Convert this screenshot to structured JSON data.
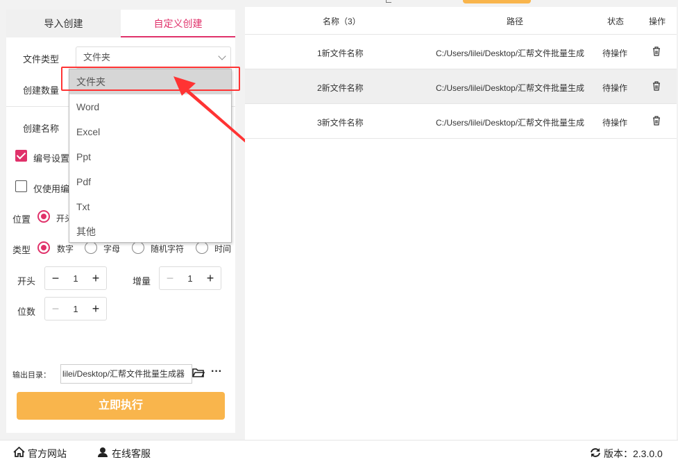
{
  "tabs": [
    {
      "label": "导入创建",
      "active": false
    },
    {
      "label": "自定义创建",
      "active": true
    }
  ],
  "form": {
    "file_type_label": "文件类型",
    "file_type_value": "文件夹",
    "create_count_label": "创建数量",
    "create_name_label": "创建名称",
    "numbering_label": "编号设置",
    "numbering_checked": true,
    "only_number_label": "仅使用编",
    "only_number_checked": false,
    "position_label": "位置",
    "position_option": "开头",
    "type_label": "类型",
    "type_options": [
      {
        "label": "数字",
        "selected": true
      },
      {
        "label": "字母",
        "selected": false
      },
      {
        "label": "随机字符",
        "selected": false
      },
      {
        "label": "时间",
        "selected": false
      }
    ],
    "start_label": "开头",
    "start_value": "1",
    "increment_label": "增量",
    "increment_value": "1",
    "digits_label": "位数",
    "digits_value": "1",
    "output_label": "输出目录：",
    "output_value": "lilei/Desktop/汇帮文件批量生成器",
    "execute_label": "立即执行"
  },
  "dropdown": {
    "options": [
      "文件夹",
      "Word",
      "Excel",
      "Ppt",
      "Pdf",
      "Txt",
      "其他"
    ],
    "selected_index": 0
  },
  "table": {
    "headers": {
      "name": "名称（3）",
      "path": "路径",
      "status": "状态",
      "action": "操作"
    },
    "rows": [
      {
        "name": "1新文件名称",
        "path": "C:/Users/lilei/Desktop/汇帮文件批量生成",
        "status": "待操作"
      },
      {
        "name": "2新文件名称",
        "path": "C:/Users/lilei/Desktop/汇帮文件批量生成",
        "status": "待操作"
      },
      {
        "name": "3新文件名称",
        "path": "C:/Users/lilei/Desktop/汇帮文件批量生成",
        "status": "待操作"
      }
    ]
  },
  "footer": {
    "website": "官方网站",
    "support": "在线客服",
    "version": "版本：2.3.0.0"
  },
  "colors": {
    "accent": "#e0316a",
    "orange": "#f9b54c",
    "annotation": "#ff3333"
  }
}
